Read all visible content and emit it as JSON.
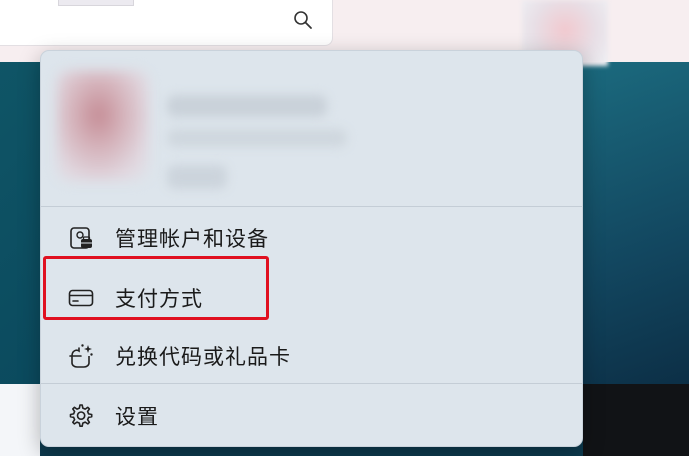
{
  "search": {
    "icon": "search-icon"
  },
  "account": {
    "avatar_icon": "avatar",
    "name": "",
    "email": ""
  },
  "menu": {
    "items": [
      {
        "label": "管理帐户和设备",
        "icon": "manage-account-icon"
      },
      {
        "label": "支付方式",
        "icon": "credit-card-icon"
      },
      {
        "label": "兑换代码或礼品卡",
        "icon": "redeem-gift-icon"
      },
      {
        "label": "设置",
        "icon": "gear-icon"
      }
    ]
  },
  "annotation": {
    "highlight_color": "#e01020",
    "highlighted_item": "支付方式"
  },
  "colors": {
    "flyout_bg": "#dde5ec",
    "text": "#1a1a1a",
    "wallpaper": "#0b4a5e"
  }
}
